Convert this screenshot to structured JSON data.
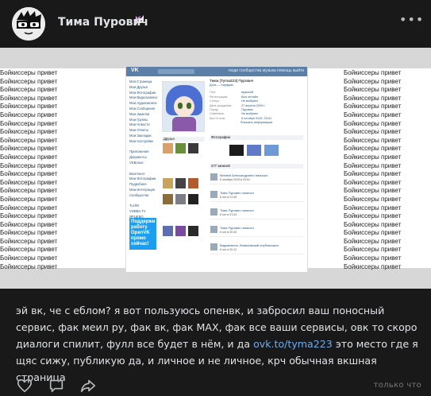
{
  "post": {
    "author_name": "Тима Пурович",
    "text_before_link": "эй вк, че с еблом? я вот пользуюсь опенвк, и забросил ваш поносный сервис, фак меил ру, фак вк, фак МАХ, фак все ваши сервисы, овк то скоро диалоги спилит, фулл все будет в нём, и да ",
    "link_text": "ovk.to/tyma223",
    "text_after_link": " это место где я щяс сижу, публикую да, и личное и не личное, крч обычная вкшная страница",
    "privacy_label": "только что"
  },
  "photo": {
    "repeated_text": "Бойкиссеры привет",
    "left_lines": [
      "Бойкиссеры привет",
      "Бойкиссеры привет",
      "Бойкиссеры привет",
      "Бойкиссеры привет",
      "Бойкиссеры привет",
      "Бойкиссеры привет",
      "Бойкиссеры привет",
      "Бойкиссеры привет",
      "Бойкиссеры привет",
      "Бойкиссеры привет",
      "Бойкиссеры привет",
      "Бойкиссеры привет",
      "Бойкиссеры привет",
      "Бойкиссеры привет",
      "Бойкиссеры привет",
      "Бойкиссеры привет",
      "Бойкиссеры привет",
      "Бойкиссеры привет",
      "Бойкиссеры привет",
      "Бойкиссеры привет",
      "Бойкиссеры привет",
      "Бойкиссеры привет",
      "Бойкиссеры привет",
      "Бойкиссеры привет"
    ],
    "right_lines": [
      "Бойкиссеры привет",
      "Бойкиссеры привет",
      "Бойкиссеры привет",
      "Бойкиссеры привет",
      "Бойкиссеры привет",
      "Бойкиссеры привет",
      "Бойкиссеры привет",
      "Бойкиссеры привет",
      "Бойкиссеры привет",
      "Бойкиссеры привет",
      "Бойкиссеры привет",
      "Бойкиссеры привет",
      "Бойкиссеры привет",
      "Бойкиссеры привет",
      "Бойкиссеры привет",
      "Бойкиссеры привет",
      "Бойкиссеры привет",
      "Бойкиссеры привет",
      "Бойкиссеры привет",
      "Бойкиссеры привет",
      "Бойкиссеры привет",
      "Бойкиссеры привет",
      "Бойкиссеры привет",
      "Бойкиссеры привет"
    ],
    "shot": {
      "logo": "VK",
      "nav": "люди   сообщества   музыка   помощь   выйти",
      "menu": [
        "Моя Страница",
        "Мои Друзья",
        "Мои Фотографии",
        "Мои Видеозаписи",
        "Мои Аудиозаписи",
        "Мои Сообщения",
        "Мои Заметки",
        "Мои Группы",
        "Мои Новости",
        "Мои Ответы",
        "Мои Закладки",
        "Мои Настройки",
        "",
        "Приложения",
        "Документы",
        "VKBonus",
        "",
        "Вконтакте",
        "Мои Фотографии",
        "Подробнее",
        "Мои Интеграция",
        "Сообщества",
        "",
        "TuchR",
        "VOBBA TV",
        "ЯРЦЕВО",
        "ЭДИТОР"
      ],
      "ad_text": "Поддержи работу OpenVK прямо сейчас!",
      "profile_name": "Тима [Tyma223] Пурович",
      "profile_status": "Дочь — Кирфрик",
      "info_rows": [
        {
          "k": "Пол:",
          "v": "мужской"
        },
        {
          "k": "Регистрация:",
          "v": "был онлайн"
        },
        {
          "k": "Статус:",
          "v": "Не выбрано"
        },
        {
          "k": "День рождения:",
          "v": "27 апреля 2009 г."
        },
        {
          "k": "Город:",
          "v": "Пурович"
        },
        {
          "k": "Семейное:",
          "v": "Не выбрано"
        },
        {
          "k": "Был в сети:",
          "v": "6 октября 2025, 23:51"
        }
      ],
      "show_more": "Показать информацию",
      "photos_title": "Фотографии",
      "wall_title": "277 записей",
      "friends_title": "Друзья",
      "posts": [
        {
          "name": "Матвей Александрович написал",
          "text": "6 октября 2025 в 23:51"
        },
        {
          "name": "Тима Пурович написал",
          "text": "6 окт в 21:45"
        },
        {
          "name": "Тима Пурович написал",
          "text": "6 окт в 21:43"
        },
        {
          "name": "Тима Пурович написал",
          "text": "6 окт в 20:40"
        },
        {
          "name": "Вадимовичъ Ломановский опубликовал",
          "text": "6 окт в 20:12"
        }
      ]
    }
  },
  "colors": {
    "background": "#19191a",
    "text": "#e1e3e6",
    "link": "#71aaeb",
    "muted": "#76787a",
    "vk_blue": "#5b7fa6"
  },
  "icons": [
    "avatar-glasses-icon",
    "cat-badge-icon",
    "more-dots-icon",
    "like-heart-icon",
    "comment-icon",
    "share-icon"
  ]
}
